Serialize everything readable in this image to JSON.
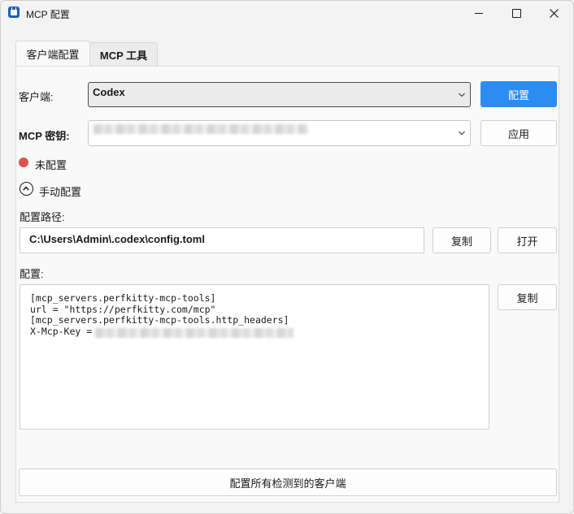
{
  "window": {
    "title": "MCP 配置",
    "controls": [
      "minimize-icon",
      "maximize-icon",
      "close-icon"
    ]
  },
  "tabs": [
    {
      "label": "客户端配置",
      "active": true
    },
    {
      "label": "MCP 工具",
      "active": false
    }
  ],
  "client": {
    "label": "客户端:",
    "selected": "Codex",
    "configure_button": "配置"
  },
  "key": {
    "label": "MCP 密钥:",
    "value_hidden": true,
    "apply_button": "应用"
  },
  "status": {
    "text": "未配置",
    "color": "#d9534f"
  },
  "manual": {
    "toggle_label": "手动配置",
    "path_label": "配置路径:",
    "path_value": "C:\\Users\\Admin\\.codex\\config.toml",
    "copy_button": "复制",
    "open_button": "打开"
  },
  "config": {
    "label": "配置:",
    "lines": [
      "[mcp_servers.perfkitty-mcp-tools]",
      "url = \"https://perfkitty.com/mcp\"",
      "[mcp_servers.perfkitty-mcp-tools.http_headers]",
      "X-Mcp-Key ="
    ],
    "copy_button": "复制"
  },
  "footer": {
    "configure_all_button": "配置所有检测到的客户端"
  },
  "colors": {
    "accent": "#2d8cf0",
    "status_unconfigured": "#d9534f"
  }
}
